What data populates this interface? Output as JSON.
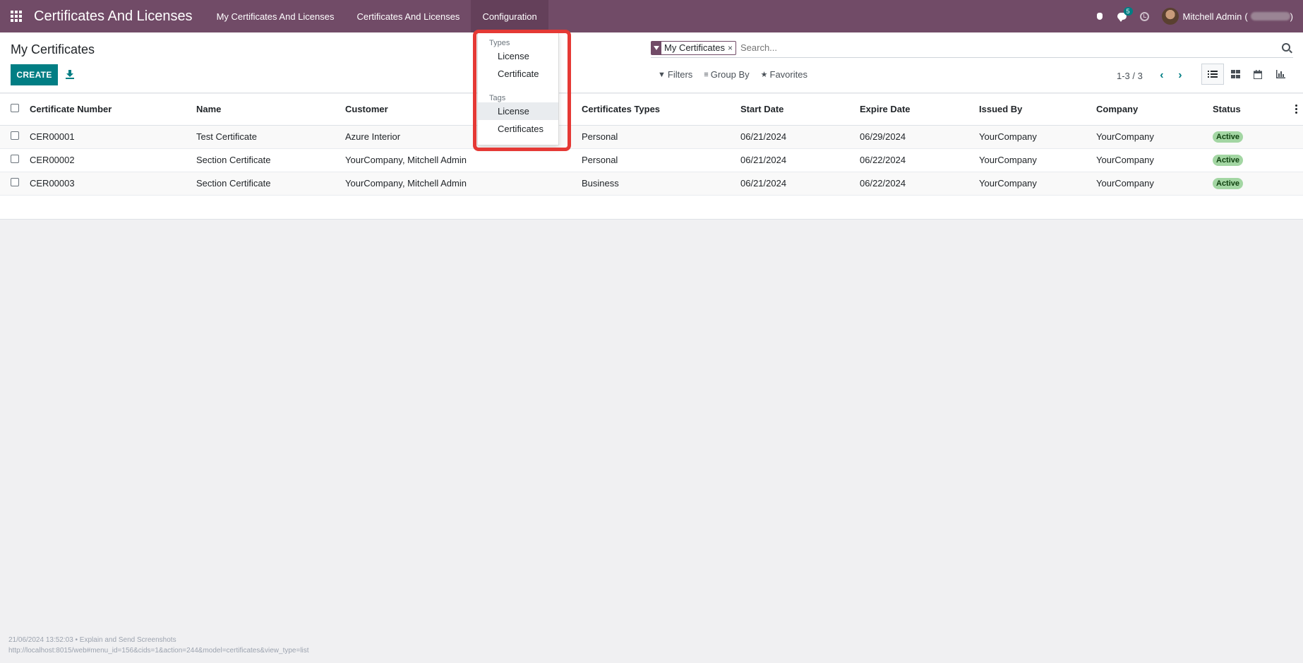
{
  "navbar": {
    "app_title": "Certificates And Licenses",
    "menu": [
      {
        "label": "My Certificates And Licenses"
      },
      {
        "label": "Certificates And Licenses"
      },
      {
        "label": "Configuration"
      }
    ],
    "messages_badge": "5",
    "user_name": "Mitchell Admin",
    "user_db_open": "(",
    "user_db_close": ")"
  },
  "page": {
    "title": "My Certificates",
    "create_label": "CREATE"
  },
  "search": {
    "facet_label": "My Certificates",
    "facet_close": "×",
    "placeholder": "Search..."
  },
  "filters": {
    "filters_label": "Filters",
    "groupby_label": "Group By",
    "favorites_label": "Favorites"
  },
  "pager": {
    "value": "1-3 / 3",
    "prev": "‹",
    "next": "›"
  },
  "table": {
    "columns": [
      "Certificate Number",
      "Name",
      "Customer",
      "Certificates Types",
      "Start Date",
      "Expire Date",
      "Issued By",
      "Company",
      "Status"
    ],
    "rows": [
      {
        "number": "CER00001",
        "name": "Test Certificate",
        "customer": "Azure Interior",
        "type": "Personal",
        "start": "06/21/2024",
        "expire": "06/29/2024",
        "issued_by": "YourCompany",
        "company": "YourCompany",
        "status": "Active"
      },
      {
        "number": "CER00002",
        "name": "Section Certificate",
        "customer": "YourCompany, Mitchell Admin",
        "type": "Personal",
        "start": "06/21/2024",
        "expire": "06/22/2024",
        "issued_by": "YourCompany",
        "company": "YourCompany",
        "status": "Active"
      },
      {
        "number": "CER00003",
        "name": "Section Certificate",
        "customer": "YourCompany, Mitchell Admin",
        "type": "Business",
        "start": "06/21/2024",
        "expire": "06/22/2024",
        "issued_by": "YourCompany",
        "company": "YourCompany",
        "status": "Active"
      }
    ]
  },
  "config_dropdown": {
    "types_header": "Types",
    "types_items": [
      "License",
      "Certificate"
    ],
    "tags_header": "Tags",
    "tags_items": [
      "License",
      "Certificates"
    ]
  },
  "footer": {
    "line1": "21/06/2024 13:52:03 • Explain and Send Screenshots",
    "line2": "http://localhost:8015/web#menu_id=156&cids=1&action=244&model=certificates&view_type=list"
  },
  "colors": {
    "navbar": "#714b67",
    "primary": "#017e84",
    "highlight": "#e53935",
    "status_active": "#a3d6a3"
  },
  "icons": [
    "apps-grid-icon",
    "bug-icon",
    "chat-icon",
    "clock-icon",
    "download-icon",
    "filter-icon",
    "search-icon",
    "list-view-icon",
    "kanban-view-icon",
    "calendar-view-icon",
    "graph-view-icon",
    "kebab-icon"
  ]
}
